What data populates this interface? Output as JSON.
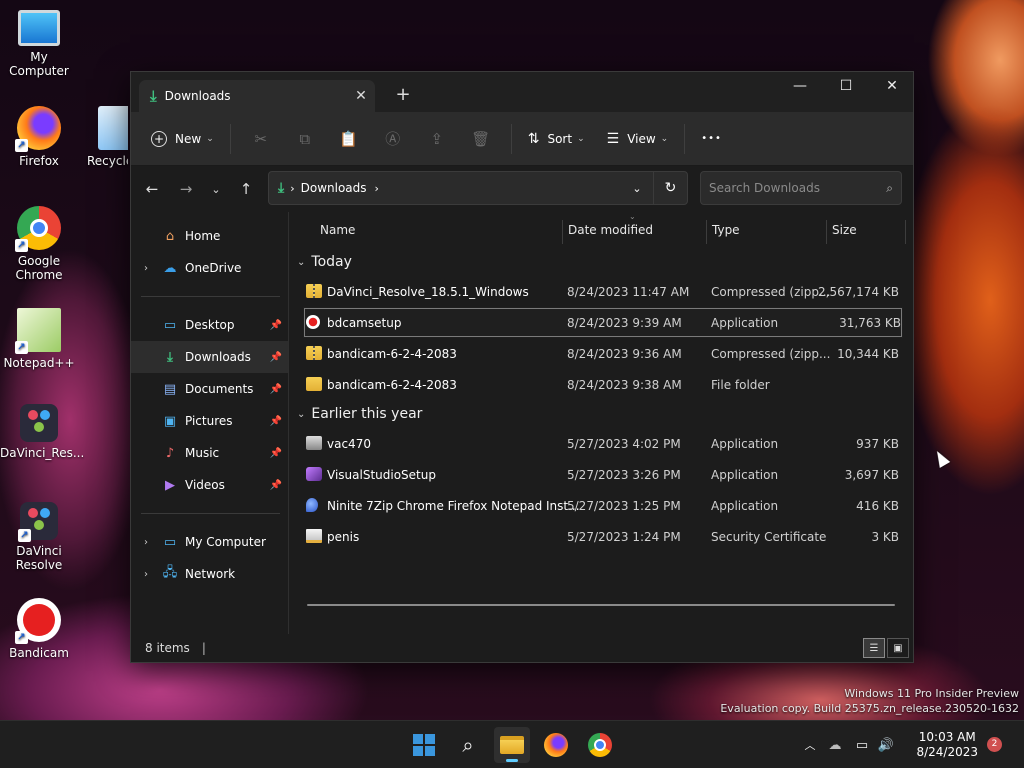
{
  "desktop": {
    "icons": [
      {
        "label": "My Computer"
      },
      {
        "label": "Firefox"
      },
      {
        "label": "Recycle"
      },
      {
        "label": "Google Chrome"
      },
      {
        "label": "Notepad++"
      },
      {
        "label": "DaVinci_Res..."
      },
      {
        "label": "DaVinci Resolve"
      },
      {
        "label": "Bandicam"
      }
    ]
  },
  "window": {
    "tab_title": "Downloads",
    "tab_close": "✕",
    "new_tab": "+",
    "controls": {
      "minimize": "—",
      "maximize": "☐",
      "close": "✕"
    }
  },
  "toolbar": {
    "new_label": "New",
    "sort_label": "Sort",
    "view_label": "View",
    "more_label": "•••"
  },
  "address": {
    "path": "Downloads",
    "search_placeholder": "Search Downloads"
  },
  "sidebar": {
    "top": [
      {
        "label": "Home",
        "icon": "home-icon"
      },
      {
        "label": "OneDrive",
        "icon": "cloud-icon"
      }
    ],
    "pinned": [
      {
        "label": "Desktop",
        "icon": "desktop-icon"
      },
      {
        "label": "Downloads",
        "icon": "download-icon"
      },
      {
        "label": "Documents",
        "icon": "document-icon"
      },
      {
        "label": "Pictures",
        "icon": "picture-icon"
      },
      {
        "label": "Music",
        "icon": "music-icon"
      },
      {
        "label": "Videos",
        "icon": "video-icon"
      }
    ],
    "bottom": [
      {
        "label": "My Computer",
        "icon": "computer-icon"
      },
      {
        "label": "Network",
        "icon": "network-icon"
      }
    ]
  },
  "columns": {
    "name": "Name",
    "date": "Date modified",
    "type": "Type",
    "size": "Size"
  },
  "groups": [
    {
      "label": "Today",
      "files": [
        {
          "name": "DaVinci_Resolve_18.5.1_Windows",
          "date": "8/24/2023 11:47 AM",
          "type": "Compressed (zipp...",
          "size": "2,567,174 KB",
          "icon": "zip-icon"
        },
        {
          "name": "bdcamsetup",
          "date": "8/24/2023 9:39 AM",
          "type": "Application",
          "size": "31,763 KB",
          "icon": "app-icon"
        },
        {
          "name": "bandicam-6-2-4-2083",
          "date": "8/24/2023 9:36 AM",
          "type": "Compressed (zipp...",
          "size": "10,344 KB",
          "icon": "zip-icon"
        },
        {
          "name": "bandicam-6-2-4-2083",
          "date": "8/24/2023 9:38 AM",
          "type": "File folder",
          "size": "",
          "icon": "folder-icon"
        }
      ]
    },
    {
      "label": "Earlier this year",
      "files": [
        {
          "name": "vac470",
          "date": "5/27/2023 4:02 PM",
          "type": "Application",
          "size": "937 KB",
          "icon": "app-icon"
        },
        {
          "name": "VisualStudioSetup",
          "date": "5/27/2023 3:26 PM",
          "type": "Application",
          "size": "3,697 KB",
          "icon": "visual-studio-icon"
        },
        {
          "name": "Ninite 7Zip Chrome Firefox Notepad Inst...",
          "date": "5/27/2023 1:25 PM",
          "type": "Application",
          "size": "416 KB",
          "icon": "ninite-icon"
        },
        {
          "name": "penis",
          "date": "5/27/2023 1:24 PM",
          "type": "Security Certificate",
          "size": "3 KB",
          "icon": "certificate-icon"
        }
      ]
    }
  ],
  "status": {
    "items": "8 items",
    "sep": "|"
  },
  "watermark": {
    "line1": "Windows 11 Pro Insider Preview",
    "line2": "Evaluation copy. Build 25375.zn_release.230520-1632"
  },
  "taskbar": {
    "time": "10:03 AM",
    "date": "8/24/2023",
    "badge": "2"
  },
  "colors": {
    "accent": "#60cdff",
    "folder": "#f6cf54",
    "download_green": "#3fbf7f"
  }
}
